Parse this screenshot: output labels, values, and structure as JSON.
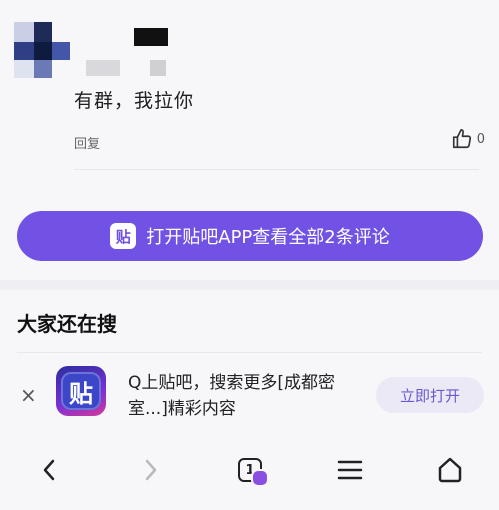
{
  "comment": {
    "text": "有群，我拉你",
    "reply_label": "回复",
    "like_count": "0"
  },
  "open_app_button": {
    "icon_glyph": "贴",
    "label": "打开贴吧APP查看全部2条评论"
  },
  "section": {
    "title": "大家还在搜"
  },
  "banner": {
    "close_glyph": "×",
    "logo_glyph": "贴",
    "text": "Q上贴吧，搜索更多[成都密室...]精彩内容",
    "button_label": "立即打开"
  },
  "nav": {
    "tab_count": "1"
  },
  "colors": {
    "accent": "#7152e4",
    "background": "#f7f6f9"
  }
}
